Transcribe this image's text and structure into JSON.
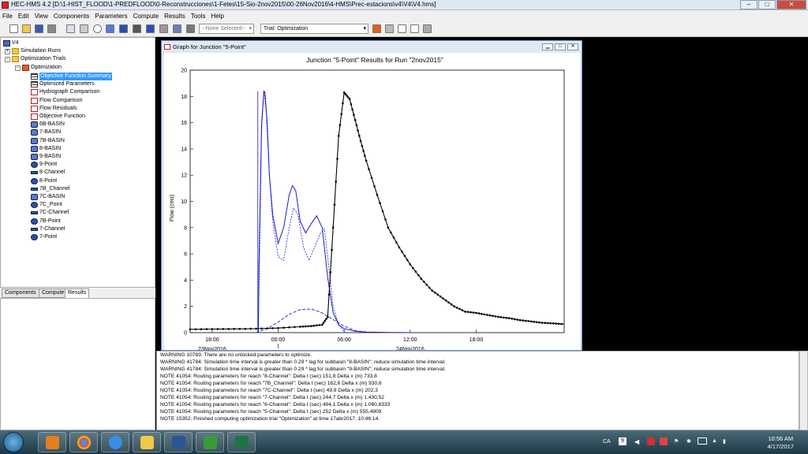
{
  "window": {
    "title": "HEC-HMS 4.2 [D:\\1-HIST_FLOOD\\1-PREDFLOOD\\0-Reconstrucciones\\1-Fetes\\15-Sio-2nov2015\\00-26Nov2016\\4-HMS\\Prec-estacions\\v4\\V4\\V4.hms]"
  },
  "menu": [
    "File",
    "Edit",
    "View",
    "Components",
    "Parameters",
    "Compute",
    "Results",
    "Tools",
    "Help"
  ],
  "toolbar": {
    "selection_dropdown": "--None Selected--",
    "trial_dropdown": "Trial: Optimization"
  },
  "tree": {
    "root": "V4",
    "simulation_runs": "Simulation Runs",
    "optimization_trials": "Optimization Trials",
    "optimization": "Optimization",
    "items": [
      {
        "label": "Objective Function Summary",
        "icon": "table",
        "selected": true
      },
      {
        "label": "Optimized Parameters",
        "icon": "table"
      },
      {
        "label": "Hydrograph Comparison",
        "icon": "graph"
      },
      {
        "label": "Flow Comparison",
        "icon": "graph"
      },
      {
        "label": "Flow Residuals",
        "icon": "graph"
      },
      {
        "label": "Objective Function",
        "icon": "graph"
      },
      {
        "label": "6B-BASIN",
        "icon": "subbasin"
      },
      {
        "label": "7-BASIN",
        "icon": "subbasin"
      },
      {
        "label": "7B-BASIN",
        "icon": "subbasin"
      },
      {
        "label": "8-BASIN",
        "icon": "subbasin"
      },
      {
        "label": "9-BASIN",
        "icon": "subbasin"
      },
      {
        "label": "9-Point",
        "icon": "junction"
      },
      {
        "label": "8-Channel",
        "icon": "reach"
      },
      {
        "label": "8-Point",
        "icon": "junction"
      },
      {
        "label": "7B_Channel",
        "icon": "reach"
      },
      {
        "label": "7C-BASIN",
        "icon": "subbasin"
      },
      {
        "label": "7C_Point",
        "icon": "junction"
      },
      {
        "label": "7C-Channel",
        "icon": "reach"
      },
      {
        "label": "7B-Point",
        "icon": "junction"
      },
      {
        "label": "7-Channel",
        "icon": "reach"
      },
      {
        "label": "7-Point",
        "icon": "junction"
      }
    ]
  },
  "tabs": [
    "Components",
    "Compute",
    "Results"
  ],
  "graph_window": {
    "title": "Graph for Junction \"5-Point\""
  },
  "chart_data": {
    "type": "line",
    "title": "Junction \"5-Point\" Results for Run \"2nov2015\"",
    "ylabel": "Flow (cms)",
    "xlabel": "",
    "ylim": [
      0,
      20
    ],
    "yticks": [
      "0",
      "2",
      "4",
      "6",
      "8",
      "10",
      "12",
      "14",
      "16",
      "18",
      "20"
    ],
    "x_range_hours": [
      -8,
      26
    ],
    "xticks": [
      {
        "hour": -6,
        "label": "18:00"
      },
      {
        "hour": 0,
        "label": "00:00"
      },
      {
        "hour": 6,
        "label": "06:00"
      },
      {
        "hour": 12,
        "label": "12:00"
      },
      {
        "hour": 18,
        "label": "18:00"
      }
    ],
    "date_labels": [
      {
        "hour": -6,
        "label": "23Nov2016"
      },
      {
        "hour": 12,
        "label": "24Nov2016"
      }
    ],
    "series": [
      {
        "style": "solid-blue",
        "x": [
          -1.8,
          -1.75,
          -1.5,
          -1.3,
          -1.2,
          -1.0,
          -0.8,
          -0.5,
          0,
          0.5,
          1.0,
          1.3,
          1.6,
          2.0,
          2.5,
          3.0,
          3.5,
          4.0,
          4.2,
          4.5,
          5.0,
          5.5,
          6.0,
          7.0,
          8.0,
          10.0,
          12.0
        ],
        "y": [
          0.0,
          5.0,
          16.0,
          18.4,
          18.3,
          16.0,
          12.0,
          9.0,
          6.8,
          8.0,
          10.5,
          11.2,
          10.8,
          8.5,
          7.6,
          8.3,
          8.9,
          8.0,
          6.5,
          4.2,
          1.5,
          0.6,
          0.3,
          0.1,
          0.05,
          0.02,
          0.0
        ]
      },
      {
        "style": "dashed-blue-1",
        "x": [
          -1.8,
          -1.5,
          -1.3,
          -1.1,
          -0.8,
          -0.5,
          0,
          0.5,
          1.0,
          1.4,
          1.8,
          2.3,
          2.8,
          3.3,
          3.8,
          4.2,
          4.6,
          5.0,
          5.5,
          6.0
        ],
        "y": [
          0.0,
          15.5,
          18.4,
          17.0,
          12.0,
          8.5,
          5.8,
          5.5,
          8.0,
          9.5,
          9.0,
          6.5,
          5.5,
          6.5,
          7.5,
          7.9,
          5.0,
          2.0,
          0.6,
          0.1
        ]
      },
      {
        "style": "dashed-blue-2",
        "x": [
          -2.0,
          -1.0,
          0,
          1.0,
          2.0,
          3.0,
          4.0,
          5.0,
          6.0,
          7.0,
          8.0
        ],
        "y": [
          0.0,
          0.3,
          0.8,
          1.4,
          1.75,
          1.8,
          1.5,
          1.0,
          0.5,
          0.15,
          0.05
        ]
      },
      {
        "style": "black-markers",
        "x": [
          -8,
          -6,
          -4,
          -2,
          0,
          2,
          3,
          4,
          4.5,
          5,
          5.5,
          6,
          6.5,
          7,
          7.5,
          8,
          9,
          10,
          11,
          12,
          13,
          14,
          15,
          16,
          17,
          18,
          19,
          20,
          21,
          22,
          23,
          24,
          25,
          26
        ],
        "y": [
          0.25,
          0.27,
          0.28,
          0.3,
          0.35,
          0.45,
          0.5,
          0.6,
          1.2,
          8.0,
          15.0,
          18.3,
          17.8,
          16.2,
          14.6,
          13.1,
          10.5,
          8.0,
          6.5,
          5.2,
          4.1,
          3.2,
          2.6,
          2.0,
          1.6,
          1.5,
          1.35,
          1.2,
          1.1,
          0.95,
          0.85,
          0.75,
          0.7,
          0.65
        ]
      }
    ]
  },
  "console": [
    "WARNING 10783:  There are no unlocked parameters to optimize.",
    "WARNING 41784:  Simulation time interval is greater than 0.29 * lag for subbasin \"8-BASIN\"; reduce simulation time interval.",
    "WARNING 41784:  Simulation time interval is greater than 0.29 * lag for subbasin \"9-BASIN\"; reduce simulation time interval.",
    "NOTE 41054:  Routing parameters for reach \"8-Channel\": Delta t (sec) 151,8  Delta x (m) 733,8",
    "NOTE 41054:  Routing parameters for reach \"7B_Channel\": Delta t (sec) 162,6  Delta x (m) 930,6",
    "NOTE 41054:  Routing parameters for reach \"7C-Channel\": Delta t (sec) 49,9  Delta x (m) 202,3",
    "NOTE 41054:  Routing parameters for reach \"7-Channel\": Delta t (sec) 244,7  Delta x (m) 1.430,52",
    "NOTE 41054:  Routing parameters for reach \"6-Channel\": Delta t (sec) 494,1  Delta x (m) 1.060,8333",
    "NOTE 41054:  Routing parameters for reach \"5-Channel\": Delta t (sec) 252  Delta x (m) 555,4909",
    "NOTE 15352:  Finished computing optimization trial \"Optimization\" at time 17abr2017, 10:46:14."
  ],
  "taskbar": {
    "lang": "CA",
    "time": "10:56 AM",
    "date": "4/17/2017"
  }
}
